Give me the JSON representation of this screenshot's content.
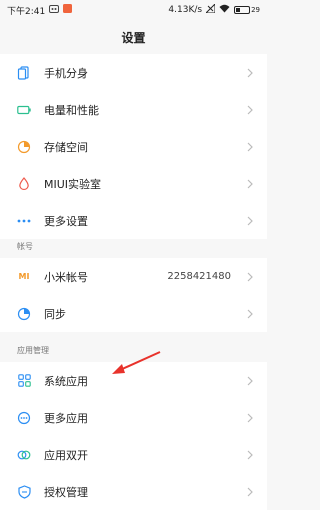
{
  "status_bar": {
    "time": "下午2:41",
    "speed": "4.13K/s",
    "battery": "29"
  },
  "header": {
    "title": "设置"
  },
  "groups": [
    {
      "items": [
        {
          "label": "手机分身",
          "icon": "clone-icon"
        },
        {
          "label": "电量和性能",
          "icon": "battery-icon"
        },
        {
          "label": "存储空间",
          "icon": "storage-pie-icon"
        },
        {
          "label": "MIUI实验室",
          "icon": "flask-drop-icon"
        },
        {
          "label": "更多设置",
          "icon": "more-dots-icon"
        }
      ]
    },
    {
      "section_label": "帐号",
      "items": [
        {
          "label": "小米帐号",
          "value": "2258421480",
          "icon": "mi-logo-icon"
        },
        {
          "label": "同步",
          "icon": "sync-icon"
        }
      ]
    },
    {
      "section_label": "应用管理",
      "items": [
        {
          "label": "系统应用",
          "icon": "apps-grid-icon"
        },
        {
          "label": "更多应用",
          "icon": "more-apps-icon"
        },
        {
          "label": "应用双开",
          "icon": "dual-apps-icon"
        },
        {
          "label": "授权管理",
          "icon": "permission-icon"
        }
      ]
    }
  ],
  "colors": {
    "accent_blue": "#2b8ef3",
    "accent_orange": "#f39a2b",
    "accent_red": "#ef5a4c",
    "annotation_arrow": "#e8322b"
  }
}
